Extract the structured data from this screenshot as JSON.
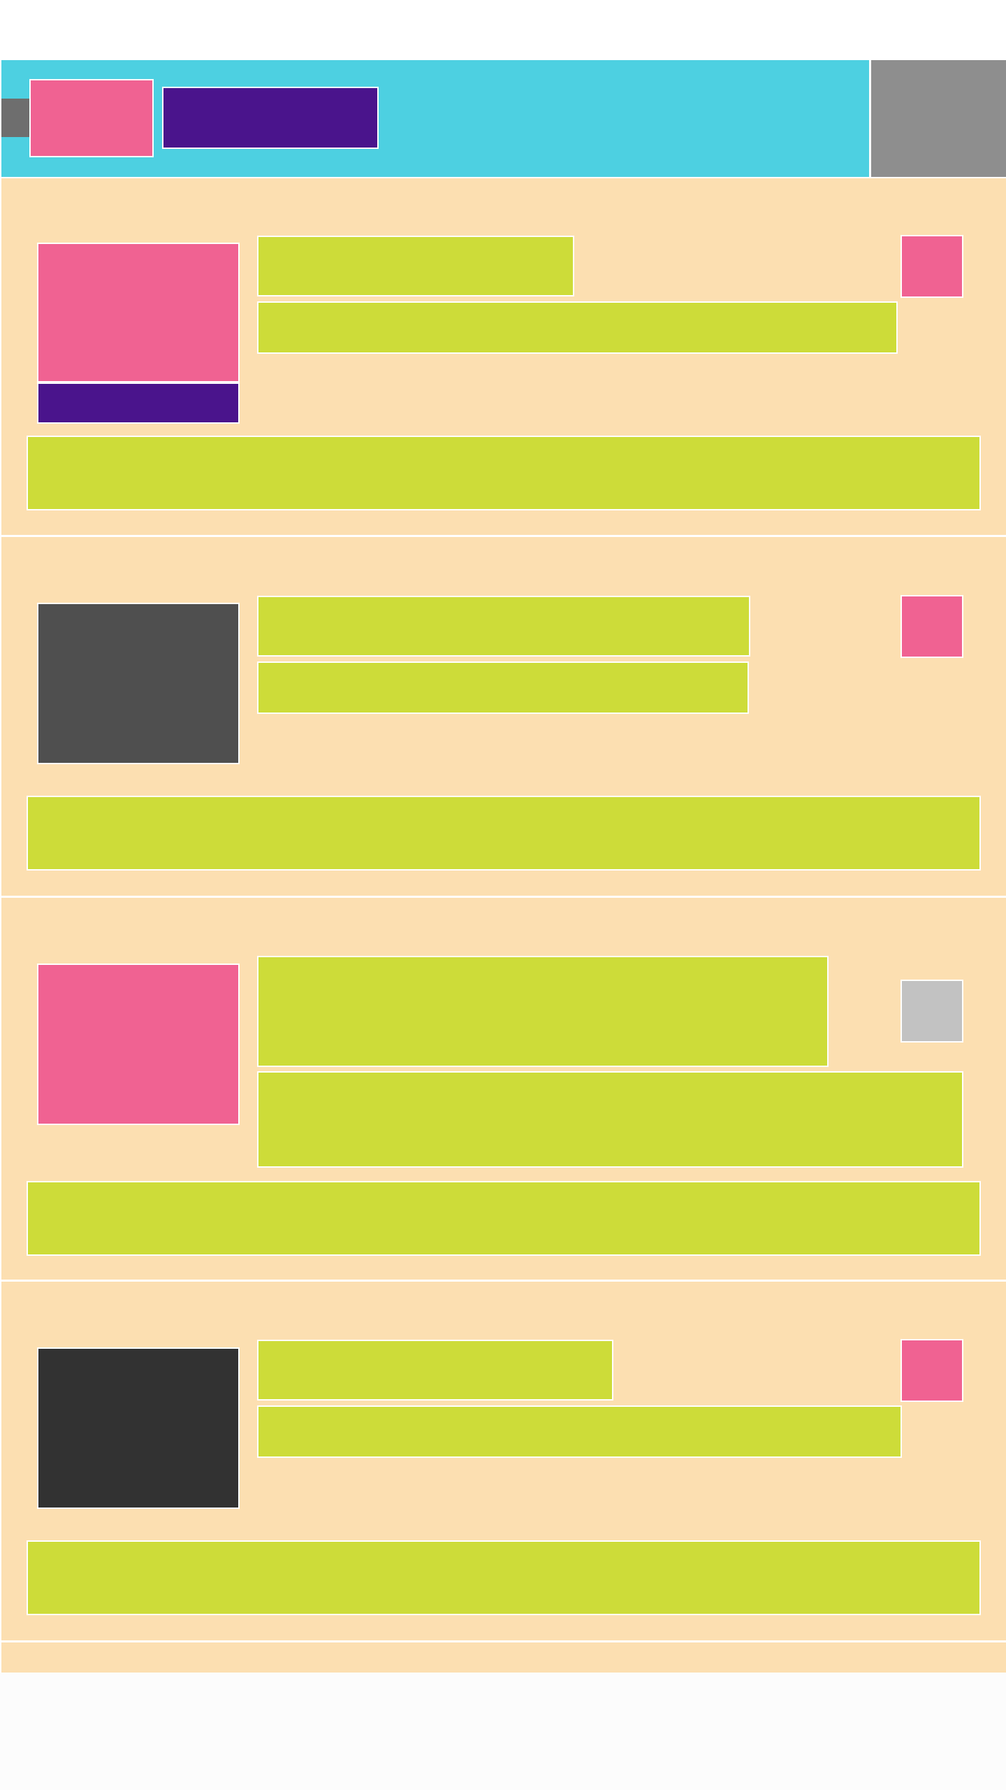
{
  "toolbar": {
    "back_icon": "back-arrow-icon",
    "logo_icon": "logo-icon",
    "title": "",
    "overflow_icon": "overflow-menu-icon"
  },
  "items": [
    {
      "thumbnail_type": "image-with-caption",
      "title": "",
      "subtitle": "",
      "action_icon": "favorite-icon",
      "action_state": "active",
      "action_button": ""
    },
    {
      "thumbnail_type": "image",
      "title": "",
      "subtitle": "",
      "action_icon": "favorite-icon",
      "action_state": "active",
      "action_button": ""
    },
    {
      "thumbnail_type": "image",
      "title": "",
      "subtitle": "",
      "action_icon": "favorite-icon",
      "action_state": "inactive",
      "action_button": ""
    },
    {
      "thumbnail_type": "image",
      "title": "",
      "subtitle": "",
      "action_icon": "favorite-icon",
      "action_state": "active",
      "action_button": ""
    }
  ],
  "colors": {
    "toolbar": "#4dd0e1",
    "card_background": "#fcdfb1",
    "text_block": "#cddc39",
    "accent_pink": "#f06292",
    "accent_purple": "#4a148c",
    "overflow_panel": "#8e8e8e"
  }
}
